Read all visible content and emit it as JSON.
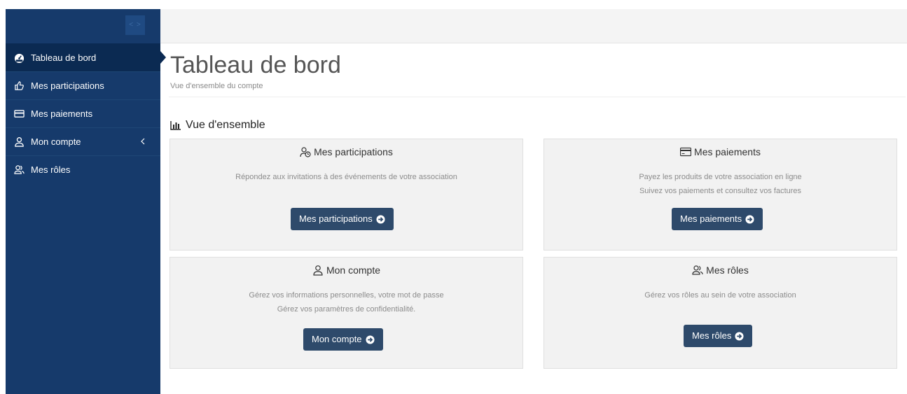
{
  "sidebar": {
    "toggle_label": "< >",
    "items": [
      {
        "label": "Tableau de bord",
        "icon": "dashboard-icon",
        "active": true
      },
      {
        "label": "Mes participations",
        "icon": "thumbs-up-icon"
      },
      {
        "label": "Mes paiements",
        "icon": "credit-card-icon"
      },
      {
        "label": "Mon compte",
        "icon": "user-icon",
        "has_chevron": true
      },
      {
        "label": "Mes rôles",
        "icon": "users-icon"
      }
    ]
  },
  "header": {
    "title": "Tableau de bord",
    "subtitle": "Vue d'ensemble du compte"
  },
  "overview": {
    "title": "Vue d'ensemble",
    "icon": "bar-chart-icon"
  },
  "cards": [
    {
      "title": "Mes participations",
      "icon": "participations-icon",
      "line1": "Répondez aux invitations à des événements de votre association",
      "line2": "",
      "button": "Mes participations"
    },
    {
      "title": "Mes paiements",
      "icon": "credit-card-icon",
      "line1": "Payez les produits de votre association en ligne",
      "line2": "Suivez vos paiements et consultez vos factures",
      "button": "Mes paiements"
    },
    {
      "title": "Mon compte",
      "icon": "user-icon",
      "line1": "Gérez vos informations personnelles, votre mot de passe",
      "line2": "Gérez vos paramètres de confidentialité.",
      "button": "Mon compte"
    },
    {
      "title": "Mes rôles",
      "icon": "users-icon",
      "line1": "Gérez vos rôles au sein de votre association",
      "line2": "",
      "button": "Mes rôles"
    }
  ],
  "colors": {
    "sidebar_bg": "#163a6b",
    "sidebar_active": "#0b2a52",
    "button_bg": "#2e4a6b",
    "card_bg": "#f2f2f2"
  }
}
